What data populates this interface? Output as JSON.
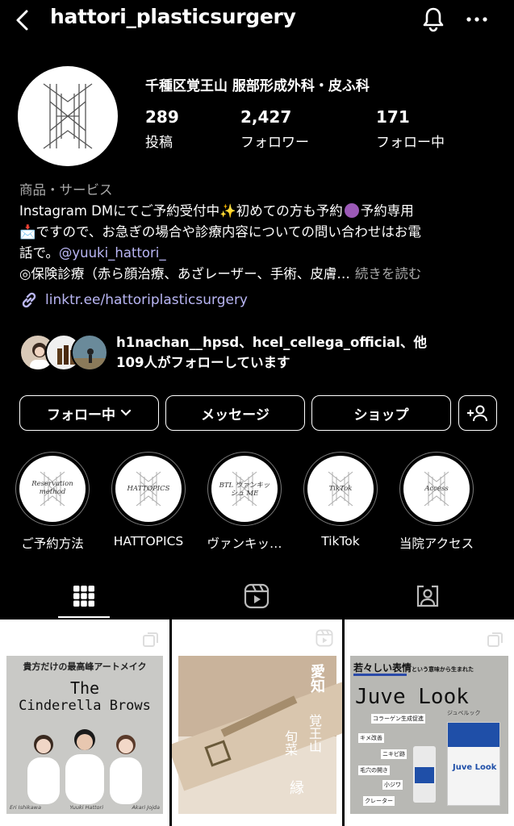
{
  "header": {
    "username": "hattori_plasticsurgery",
    "back_icon": "chevron-left-icon",
    "bell_icon": "bell-icon",
    "more_icon": "more-horizontal-icon"
  },
  "profile": {
    "name": "千種区覚王山 服部形成外科・皮ふ科",
    "stats": [
      {
        "value": "289",
        "label": "投稿"
      },
      {
        "value": "2,427",
        "label": "フォロワー"
      },
      {
        "value": "171",
        "label": "フォロー中"
      }
    ]
  },
  "bio": {
    "category": "商品・サービス",
    "line1": "Instagram DMにてご予約受付中",
    "line1b": "初めての方も予約",
    "line1c": "予約専用",
    "line2": "ですので、お急ぎの場合や診療内容についての問い合わせはお電",
    "line3a": "話で。",
    "mention": "@yuuki_hattori_",
    "line4": "◎保険診療（赤ら顔治療、あざレーザー、手術、皮膚…",
    "more": "続きを読む",
    "link": "linktr.ee/hattoriplasticsurgery"
  },
  "followed_by": {
    "line1": "h1nachan__hpsd、hcel_cellega_official、他",
    "line2": "109人がフォローしています"
  },
  "buttons": {
    "following": "フォロー中",
    "message": "メッセージ",
    "shop": "ショップ"
  },
  "highlights": [
    {
      "label": "ご予約方法",
      "cover": "Reservation method"
    },
    {
      "label": "HATTOPICS",
      "cover": "HATTOPICS"
    },
    {
      "label": "ヴァンキッ…",
      "cover": "BTL ヴァンキッシュ ME"
    },
    {
      "label": "TikTok",
      "cover": "TikTok"
    },
    {
      "label": "当院アクセス",
      "cover": "Access"
    }
  ],
  "tabs": [
    "grid-icon",
    "reels-icon",
    "tagged-icon"
  ],
  "posts": [
    {
      "top": "貴方だけの最高峰アートメイク",
      "title1": "The",
      "title2": "Cinderella Brows",
      "names": [
        "Eri Ishikawa",
        "Yuuki Hattori",
        "Akari Jojda"
      ]
    },
    {
      "text1": "愛知",
      "text2": "覚王山",
      "text3": "旬菜",
      "text4": "縁"
    },
    {
      "top": "若々しい表情",
      "top2": "という意味から生まれた",
      "title": "Juve Look",
      "sub": "ジュベルック",
      "tags": [
        "コラーゲン生成促進",
        "キメ改善",
        "ニキビ跡",
        "毛穴の開き",
        "小ジワ",
        "クレーター"
      ],
      "box": "Juve Look"
    }
  ],
  "colors": {
    "bg": "#000000",
    "link": "#b9b6f4",
    "muted": "#a8a8a8"
  }
}
